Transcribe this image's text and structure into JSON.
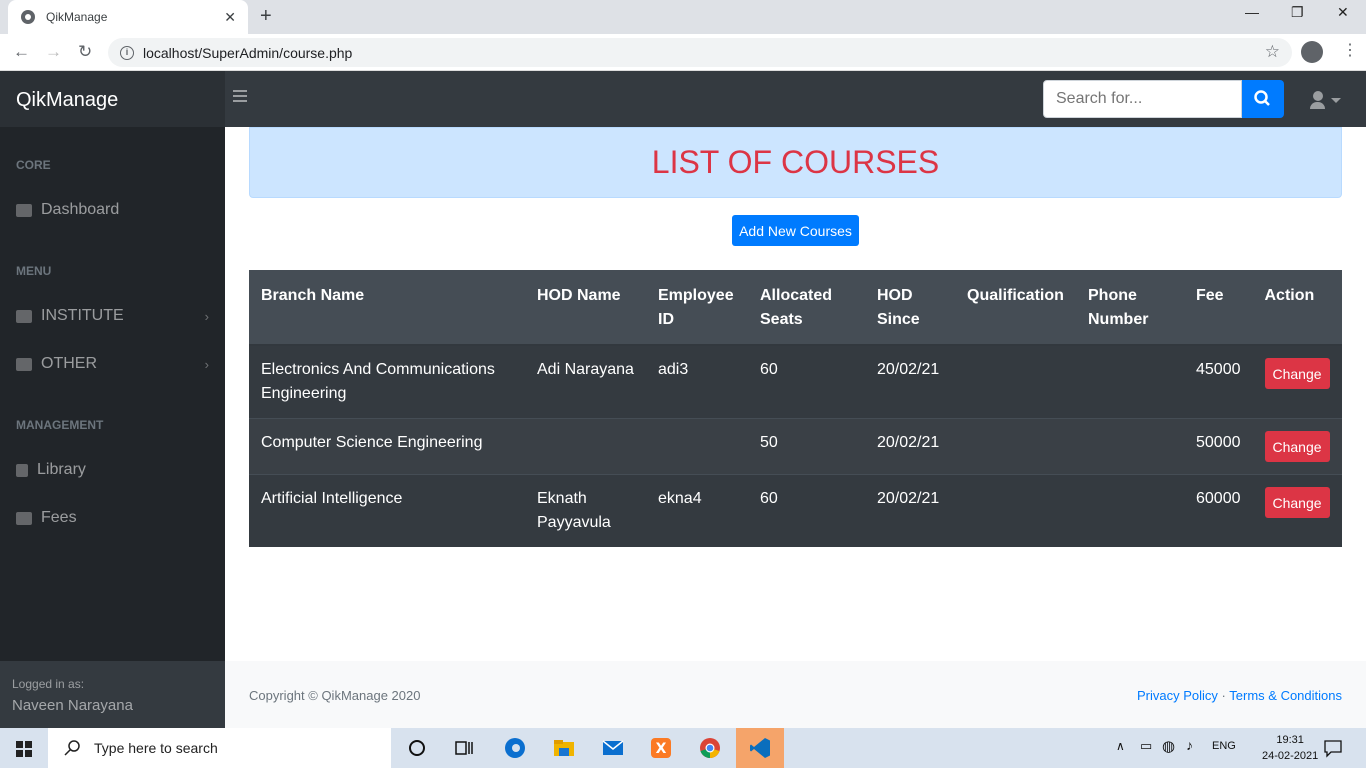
{
  "browser": {
    "tab_title": "QikManage",
    "url": "localhost/SuperAdmin/course.php"
  },
  "app": {
    "brand": "QikManage",
    "search_placeholder": "Search for..."
  },
  "sidebar": {
    "headings": [
      "CORE",
      "MENU",
      "MANAGEMENT"
    ],
    "items": [
      {
        "label": "Dashboard",
        "icon": "tachometer-icon"
      },
      {
        "label": "INSTITUTE",
        "icon": "users-icon"
      },
      {
        "label": "OTHER",
        "icon": "book-open-icon"
      },
      {
        "label": "Library",
        "icon": "book-icon"
      },
      {
        "label": "Fees",
        "icon": "credit-card-icon"
      }
    ],
    "footer_label": "Logged in as:",
    "footer_user": "Naveen Narayana"
  },
  "main": {
    "title": "LIST OF COURSES",
    "add_button": "Add New Courses",
    "columns": [
      "Branch Name",
      "HOD Name",
      "Employee ID",
      "Allocated Seats",
      "HOD Since",
      "Qualification",
      "Phone Number",
      "Fee",
      "Action"
    ],
    "rows": [
      {
        "branch": "Electronics And Communications Engineering",
        "hod": "Adi Narayana",
        "emp_id": "adi3",
        "seats": "60",
        "since": "20/02/21",
        "qual": "",
        "phone": "",
        "fee": "45000",
        "action": "Change"
      },
      {
        "branch": "Computer Science Engineering",
        "hod": "",
        "emp_id": "",
        "seats": "50",
        "since": "20/02/21",
        "qual": "",
        "phone": "",
        "fee": "50000",
        "action": "Change"
      },
      {
        "branch": "Artificial Intelligence",
        "hod": "Eknath Payyavula",
        "emp_id": "ekna4",
        "seats": "60",
        "since": "20/02/21",
        "qual": "",
        "phone": "",
        "fee": "60000",
        "action": "Change"
      }
    ]
  },
  "footer": {
    "copyright": "Copyright © QikManage 2020",
    "privacy": "Privacy Policy",
    "separator": "·",
    "terms": "Terms & Conditions"
  },
  "taskbar": {
    "search_placeholder": "Type here to search",
    "language": "ENG",
    "time": "19:31",
    "date": "24-02-2021"
  },
  "colors": {
    "accent": "#007bff",
    "danger": "#dc3545",
    "sidebar_bg": "#212529",
    "table_bg": "#343a40",
    "banner_bg": "#cce5ff"
  }
}
